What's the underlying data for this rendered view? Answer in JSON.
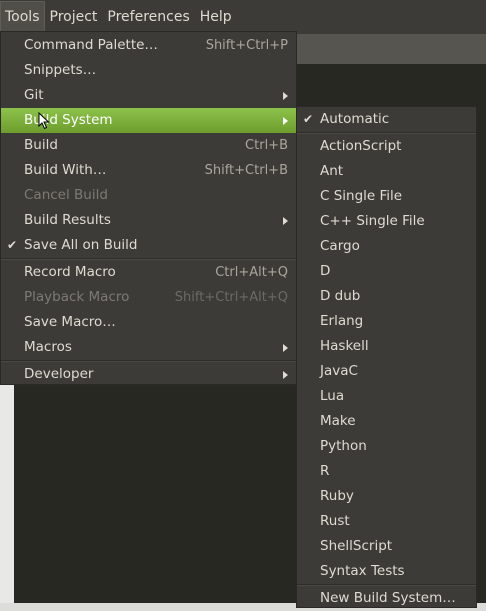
{
  "menubar": {
    "items": [
      "Tools",
      "Project",
      "Preferences",
      "Help"
    ]
  },
  "tools_menu": {
    "items": [
      {
        "label": "Command Palette…",
        "shortcut": "Shift+Ctrl+P"
      },
      {
        "label": "Snippets…"
      },
      {
        "label": "Git",
        "submenu": true
      },
      {
        "label": "Build System",
        "submenu": true,
        "highlighted": true
      },
      {
        "label": "Build",
        "shortcut": "Ctrl+B"
      },
      {
        "label": "Build With…",
        "shortcut": "Shift+Ctrl+B"
      },
      {
        "label": "Cancel Build",
        "disabled": true
      },
      {
        "label": "Build Results",
        "submenu": true
      },
      {
        "label": "Save All on Build",
        "checked": true
      },
      {
        "label": "Record Macro",
        "shortcut": "Ctrl+Alt+Q"
      },
      {
        "label": "Playback Macro",
        "shortcut": "Shift+Ctrl+Alt+Q",
        "disabled": true
      },
      {
        "label": "Save Macro…"
      },
      {
        "label": "Macros",
        "submenu": true
      },
      {
        "label": "Developer",
        "submenu": true
      }
    ]
  },
  "build_system_menu": {
    "items": [
      {
        "label": "Automatic",
        "checked": true
      },
      {
        "label": "ActionScript"
      },
      {
        "label": "Ant"
      },
      {
        "label": "C Single File"
      },
      {
        "label": "C++ Single File"
      },
      {
        "label": "Cargo"
      },
      {
        "label": "D"
      },
      {
        "label": "D dub"
      },
      {
        "label": "Erlang"
      },
      {
        "label": "Haskell"
      },
      {
        "label": "JavaC"
      },
      {
        "label": "Lua"
      },
      {
        "label": "Make"
      },
      {
        "label": "Python"
      },
      {
        "label": "R"
      },
      {
        "label": "Ruby"
      },
      {
        "label": "Rust"
      },
      {
        "label": "ShellScript"
      },
      {
        "label": "Syntax Tests"
      },
      {
        "label": "New Build System…"
      }
    ]
  },
  "icons": {
    "check": "checkmark-icon",
    "submenu": "chevron-right-icon",
    "pointer": "mouse-pointer-icon"
  },
  "colors": {
    "highlight": "#8cc24a",
    "menu_bg": "#3c3b37",
    "editor_bg": "#272822"
  }
}
